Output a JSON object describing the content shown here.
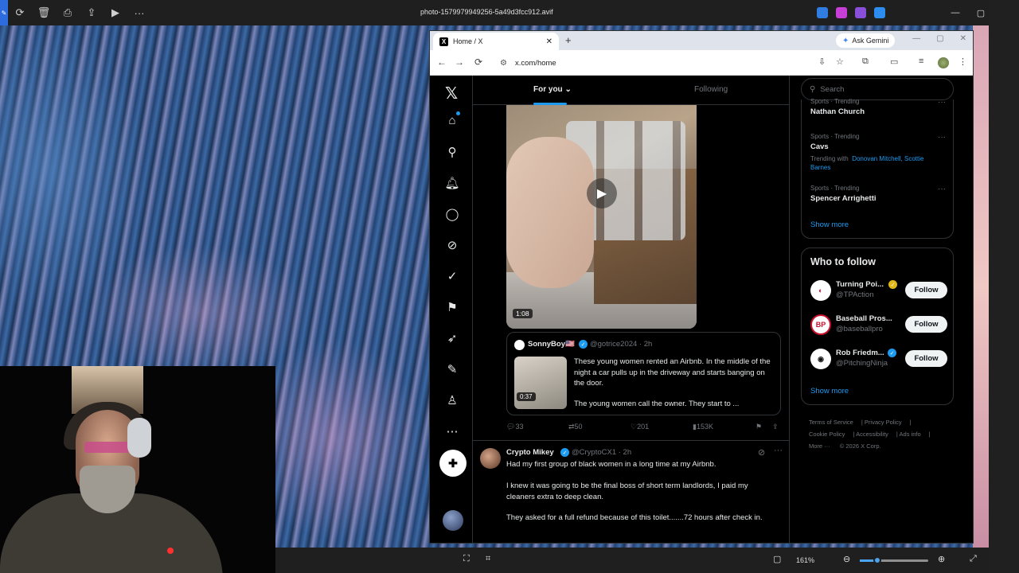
{
  "viewer": {
    "filename": "photo-1579979949256-5a49d3fcc912.avif",
    "zoom": "161%",
    "toolbar_icons": [
      "rotate-icon",
      "delete-icon",
      "print-icon",
      "share-icon",
      "slideshow-icon",
      "more-icon"
    ],
    "window_controls": [
      "—",
      "▢",
      "✕"
    ]
  },
  "browser": {
    "tab_title": "Home / X",
    "tab_close": "✕",
    "new_tab": "+",
    "url": "x.com/home",
    "ask_gemini": "Ask Gemini"
  },
  "timeline": {
    "tab_for_you": "For you",
    "tab_following": "Following",
    "video_duration": "1:08",
    "quote": {
      "name": "SonnyBoy🇺🇸",
      "handle": "@gotrice2024 · 2h",
      "thumb_duration": "0:37",
      "text": "These young women rented an Airbnb. In the middle of the night a car pulls up in the driveway and starts banging on the door.",
      "text2": "The young women call the owner. They start to ..."
    },
    "actions": {
      "replies": "33",
      "reposts": "50",
      "likes": "201",
      "views": "153K"
    },
    "tweet2": {
      "name": "Crypto Mikey",
      "handle": "@CryptoCX1 · 2h",
      "p1": "Had my first group of black women in a long time at my Airbnb.",
      "p2": "I knew it was going to be the final boss of short term landlords, I paid my cleaners extra to deep clean.",
      "p3": "They asked for a full refund because of this toilet.......72 hours after check in."
    }
  },
  "sidebar": {
    "search_placeholder": "Search",
    "trends": [
      {
        "context": "Sports · Trending",
        "name": "Nathan Church"
      },
      {
        "context": "Sports · Trending",
        "name": "Cavs",
        "with_label": "Trending with",
        "with_names": "Donovan Mitchell, Scottie Barnes"
      },
      {
        "context": "Sports · Trending",
        "name": "Spencer Arrighetti"
      }
    ],
    "show_more": "Show more",
    "who_to_follow": "Who to follow",
    "follow": [
      {
        "name": "Turning Poi...",
        "handle": "@TPAction",
        "avatar": "◐",
        "verified_color": "#e2b719"
      },
      {
        "name": "Baseball Pros...",
        "handle": "@baseballpro",
        "avatar": "BP"
      },
      {
        "name": "Rob Friedm...",
        "handle": "@PitchingNinja",
        "avatar": "◉",
        "verified_color": "#1d9bf0"
      }
    ],
    "follow_label": "Follow",
    "footer": [
      "Terms of Service",
      "Privacy Policy",
      "Cookie Policy",
      "Accessibility",
      "Ads info",
      "More ···",
      "© 2026 X Corp."
    ]
  },
  "colors": {
    "accent": "#1d9bf0",
    "background": "#000000",
    "border": "#2f3336",
    "muted_text": "#71767b"
  }
}
